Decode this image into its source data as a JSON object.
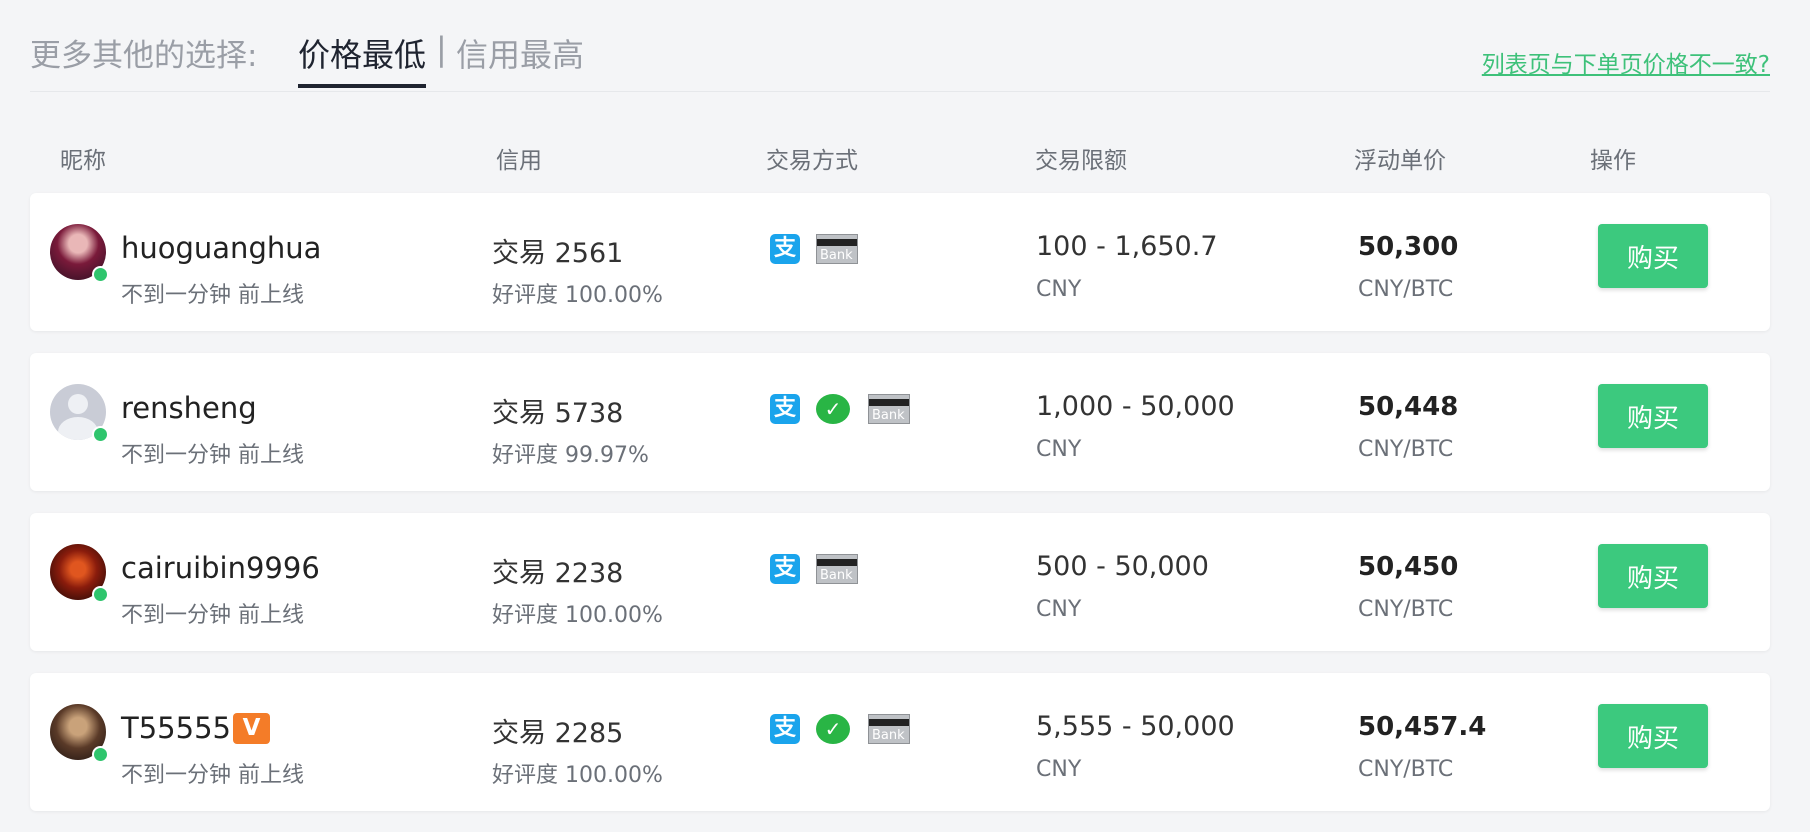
{
  "filter": {
    "more_options_label": "更多其他的选择:",
    "tab_lowest_price": "价格最低",
    "separator": "|",
    "tab_highest_credit": "信用最高",
    "inconsistency_link": "列表页与下单页价格不一致?"
  },
  "table": {
    "headers": {
      "nickname": "昵称",
      "credit": "信用",
      "payment": "交易方式",
      "limit": "交易限额",
      "price": "浮动单价",
      "action": "操作"
    },
    "rows": [
      {
        "nickname": "huoguanghua",
        "online_status": "不到一分钟 前上线",
        "trades": "交易 2561",
        "rating": "好评度 100.00%",
        "payment_methods": [
          "alipay",
          "bank"
        ],
        "limit": "100 - 1,650.7",
        "limit_currency": "CNY",
        "price": "50,300",
        "price_unit": "CNY/BTC",
        "action": "购买"
      },
      {
        "nickname": "rensheng",
        "online_status": "不到一分钟 前上线",
        "trades": "交易 5738",
        "rating": "好评度 99.97%",
        "payment_methods": [
          "alipay",
          "wechat",
          "bank"
        ],
        "limit": "1,000 - 50,000",
        "limit_currency": "CNY",
        "price": "50,448",
        "price_unit": "CNY/BTC",
        "action": "购买"
      },
      {
        "nickname": "cairuibin9996",
        "online_status": "不到一分钟 前上线",
        "trades": "交易 2238",
        "rating": "好评度 100.00%",
        "payment_methods": [
          "alipay",
          "bank"
        ],
        "limit": "500 - 50,000",
        "limit_currency": "CNY",
        "price": "50,450",
        "price_unit": "CNY/BTC",
        "action": "购买"
      },
      {
        "nickname": "T55555",
        "vip_badge": "V",
        "online_status": "不到一分钟 前上线",
        "trades": "交易 2285",
        "rating": "好评度 100.00%",
        "payment_methods": [
          "alipay",
          "wechat",
          "bank"
        ],
        "limit": "5,555 - 50,000",
        "limit_currency": "CNY",
        "price": "50,457.4",
        "price_unit": "CNY/BTC",
        "action": "购买"
      }
    ]
  },
  "icons": {
    "alipay_glyph": "支",
    "wechat_glyph": "✓",
    "bank_text": "Bank"
  },
  "colors": {
    "accent_green": "#3cc97e",
    "online_green": "#2fc56d",
    "vip_orange": "#f47c28",
    "alipay_blue": "#1aa4ec",
    "wechat_green": "#29b545"
  }
}
